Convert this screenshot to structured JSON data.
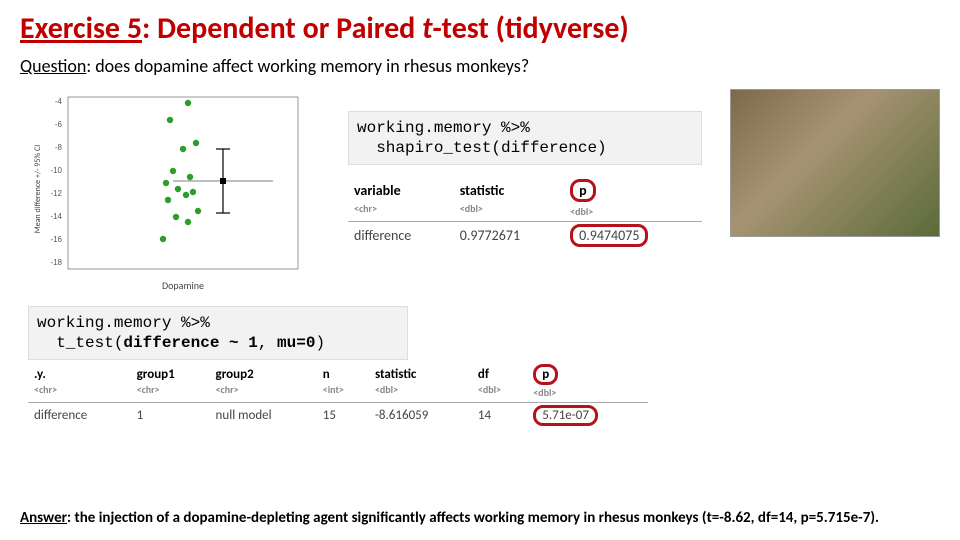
{
  "title": {
    "exercise": "Exercise 5",
    "rest_before_t": ": Dependent or Paired ",
    "t": "t",
    "rest_after_t": "-test (tidyverse)"
  },
  "question": {
    "label": "Question",
    "text": ": does dopamine affect working memory in rhesus monkeys?"
  },
  "code_shapiro": "working.memory %>%\n  shapiro_test(difference)",
  "shapiro": {
    "headers": [
      "variable",
      "statistic",
      "p"
    ],
    "sub": [
      "<chr>",
      "<dbl>",
      "<dbl>"
    ],
    "row": [
      "difference",
      "0.9772671",
      "0.9474075"
    ]
  },
  "code_ttest_line1": "working.memory %>%",
  "code_ttest_line2a": "  t_test(",
  "code_ttest_line2b": "difference ~ 1",
  "code_ttest_line2c": ", ",
  "code_ttest_line2d": "mu=0",
  "code_ttest_line2e": ")",
  "ttest": {
    "headers": [
      ".y.",
      "group1",
      "group2",
      "n",
      "statistic",
      "df",
      "p"
    ],
    "sub": [
      "<chr>",
      "<chr>",
      "<chr>",
      "<int>",
      "<dbl>",
      "<dbl>",
      "<dbl>"
    ],
    "row": [
      "difference",
      "1",
      "null model",
      "15",
      "-8.616059",
      "14",
      "5.71e-07"
    ]
  },
  "answer": {
    "label": "Answer",
    "text": ": the injection of a dopamine-depleting agent significantly affects working memory in rhesus monkeys (t=-8.62, df=14, p=5.715e-7)."
  },
  "chart_data": {
    "type": "scatter",
    "title": "",
    "xlabel": "Dopamine",
    "ylabel": "Mean difference +/- 95% CI",
    "ylim": [
      -18,
      0
    ],
    "yticks": [
      -18,
      -16,
      -14,
      -12,
      -10,
      -8,
      -6,
      -4
    ],
    "x_categories": [
      "Dopamine"
    ],
    "series": [
      {
        "name": "difference",
        "values": [
          -16,
          -14.5,
          -14,
          -13.5,
          -12.5,
          -12,
          -11.8,
          -11.5,
          -11,
          -10.5,
          -10,
          -8,
          -7.5,
          -5.5,
          -4
        ]
      }
    ],
    "summary": {
      "mean": -10.87,
      "ci_low": -13.6,
      "ci_high": -8.1
    }
  },
  "photo_alt": "two rhesus monkeys"
}
